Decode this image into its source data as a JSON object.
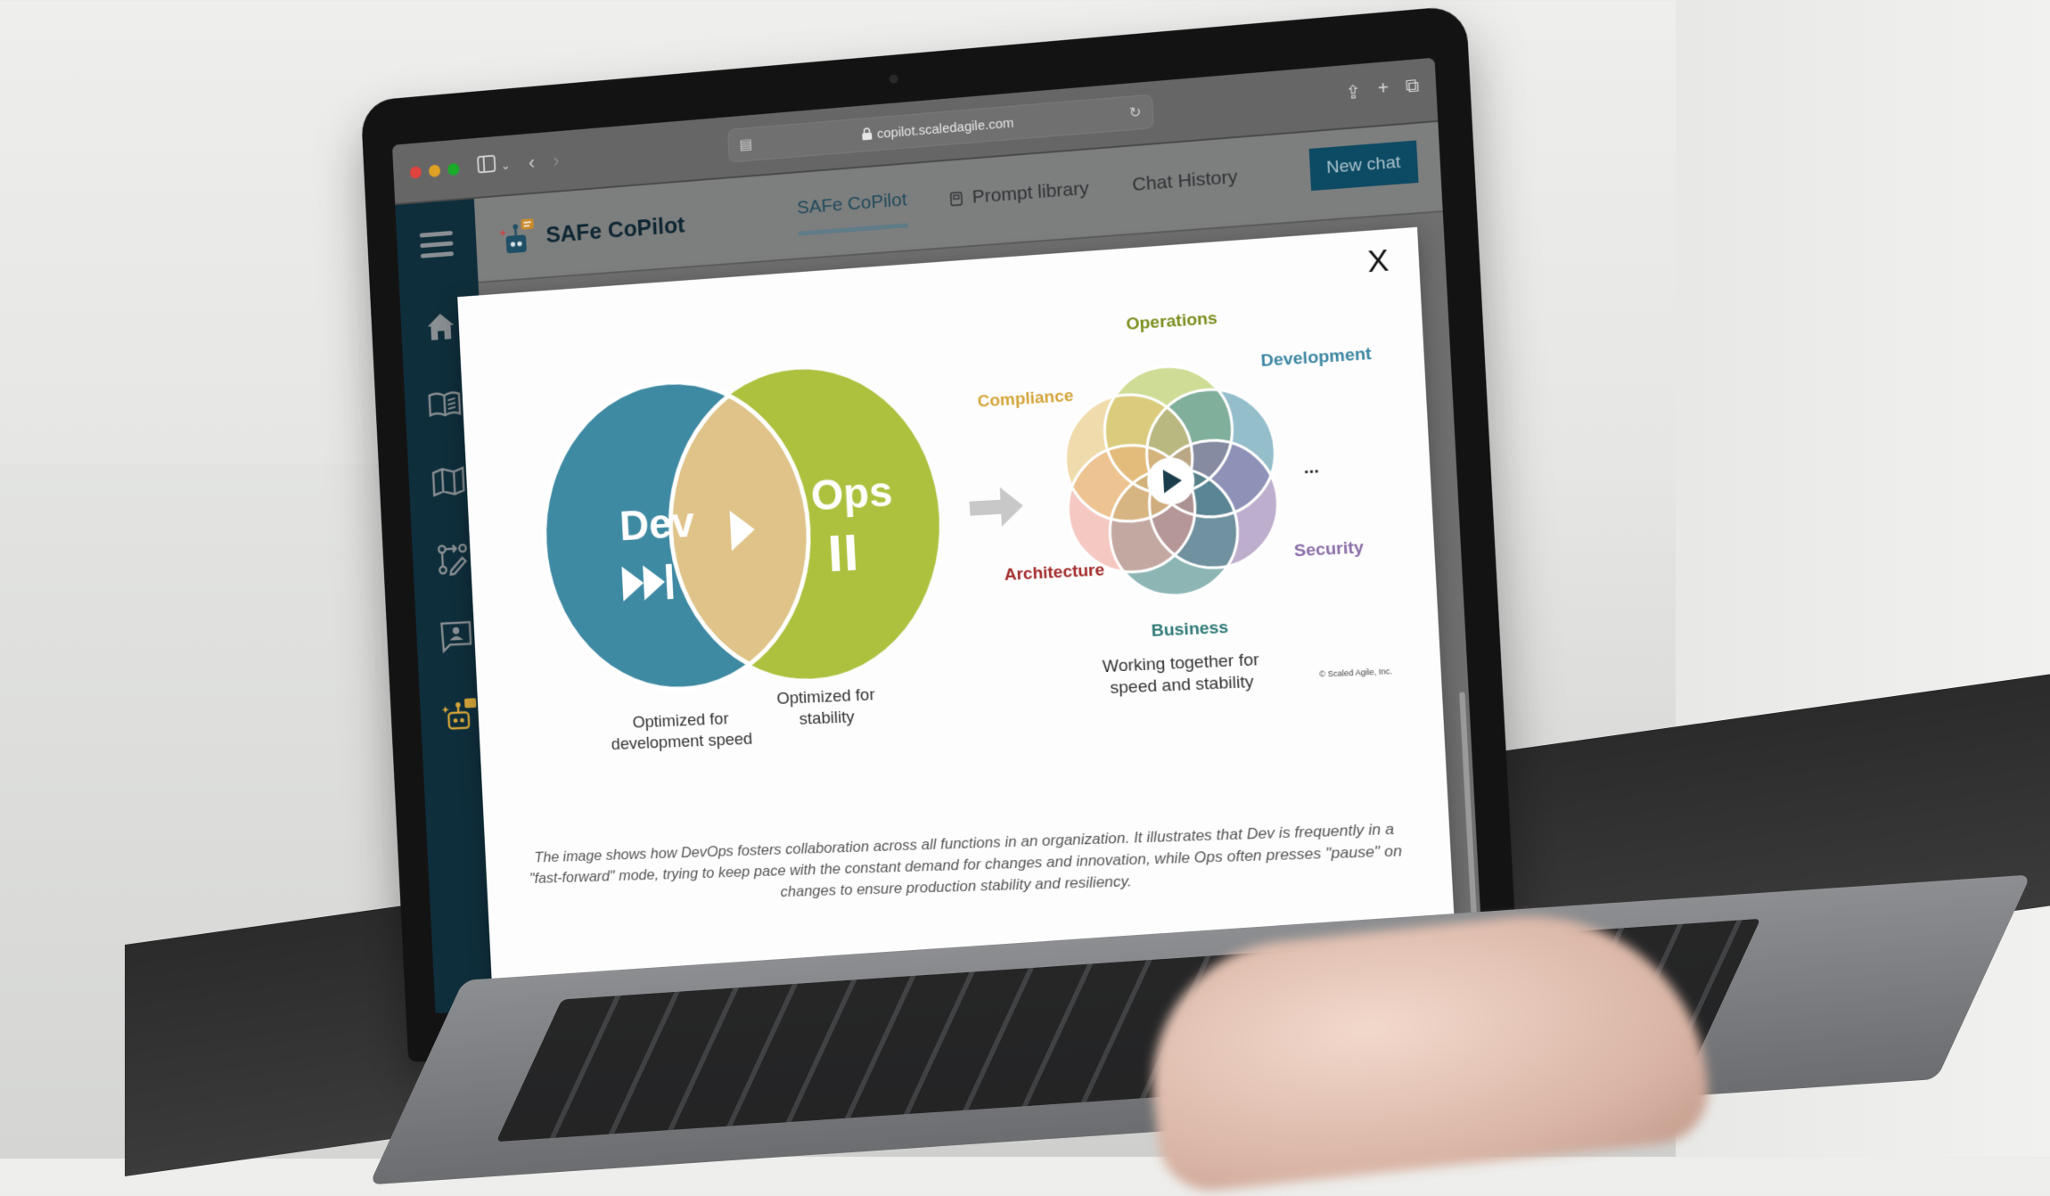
{
  "browser": {
    "url": "copilot.scaledagile.com",
    "icons": {
      "sidebar_toggle": "sidebar-icon",
      "back": "‹",
      "forward": "›",
      "share": "⇪",
      "new_tab": "+",
      "tabs_overview": "⧉",
      "reader": "▤",
      "reload": "↻",
      "lock": "🔒"
    }
  },
  "app": {
    "brand_name": "SAFe CoPilot",
    "tabs": [
      {
        "label": "SAFe CoPilot",
        "active": true
      },
      {
        "label": "Prompt library",
        "icon": "prompt-library-icon",
        "active": false
      },
      {
        "label": "Chat History",
        "active": false
      }
    ],
    "new_chat_label": "New chat",
    "sidebar": [
      {
        "name": "menu",
        "glyph": "☰"
      },
      {
        "name": "home",
        "glyph": "⌂"
      },
      {
        "name": "guide",
        "glyph": "📖"
      },
      {
        "name": "roadmap",
        "glyph": "🗺"
      },
      {
        "name": "workflow",
        "glyph": "⤳"
      },
      {
        "name": "coaching",
        "glyph": "💬"
      },
      {
        "name": "copilot",
        "glyph": "🤖",
        "active": true
      }
    ],
    "accent_color": "#0d4a63",
    "sidebar_color": "#0f2e3b"
  },
  "modal": {
    "close_label": "X",
    "figure": {
      "left": {
        "dev_label": "Dev",
        "ops_label": "Ops",
        "dev_symbol": "⏭",
        "overlap_symbol": "▶",
        "ops_symbol": "II",
        "dev_caption": [
          "Optimized for",
          "development speed"
        ],
        "ops_caption": [
          "Optimized for",
          "stability"
        ],
        "colors": {
          "dev": "#3f8aa3",
          "ops": "#adc13f",
          "overlap": "#dfc389"
        }
      },
      "right": {
        "labels": [
          {
            "text": "Operations",
            "color": "#7a8f1e"
          },
          {
            "text": "Development",
            "color": "#3c87a3"
          },
          {
            "text": "Compliance",
            "color": "#d4a53a"
          },
          {
            "text": "Architecture",
            "color": "#a32b2b"
          },
          {
            "text": "Business",
            "color": "#2f7a78"
          },
          {
            "text": "Security",
            "color": "#8b6ea8"
          },
          {
            "text": "...",
            "color": "#333333"
          }
        ],
        "caption": [
          "Working together for",
          "speed and stability"
        ],
        "petal_colors": [
          "#a9c13f",
          "#3f8aa3",
          "#8b6ea8",
          "#2f7a78",
          "#f09c92",
          "#e6bf6a"
        ]
      },
      "copyright": "© Scaled Agile, Inc."
    },
    "description": "The image shows how DevOps fosters collaboration across all functions in an organization. It illustrates that Dev is frequently in a \"fast-forward\" mode, trying to keep pace with the constant demand for changes and innovation, while Ops often presses \"pause\" on changes to ensure production stability and resiliency."
  }
}
